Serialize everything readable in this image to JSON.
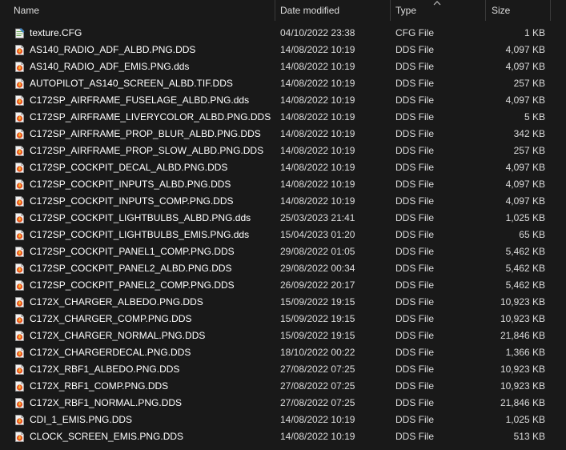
{
  "columns": {
    "name": "Name",
    "date": "Date modified",
    "type": "Type",
    "size": "Size"
  },
  "colors": {
    "background": "#191919",
    "text": "#ffffff",
    "dds_icon": "#e8531f",
    "cfg_icon": "#6aa84f"
  },
  "files": [
    {
      "name": "texture.CFG",
      "date": "04/10/2022 23:38",
      "type": "CFG File",
      "size": "1 KB",
      "icon": "cfg-file-icon"
    },
    {
      "name": "AS140_RADIO_ADF_ALBD.PNG.DDS",
      "date": "14/08/2022 10:19",
      "type": "DDS File",
      "size": "4,097 KB",
      "icon": "dds-file-icon"
    },
    {
      "name": "AS140_RADIO_ADF_EMIS.PNG.dds",
      "date": "14/08/2022 10:19",
      "type": "DDS File",
      "size": "4,097 KB",
      "icon": "dds-file-icon"
    },
    {
      "name": "AUTOPILOT_AS140_SCREEN_ALBD.TIF.DDS",
      "date": "14/08/2022 10:19",
      "type": "DDS File",
      "size": "257 KB",
      "icon": "dds-file-icon"
    },
    {
      "name": "C172SP_AIRFRAME_FUSELAGE_ALBD.PNG.dds",
      "date": "14/08/2022 10:19",
      "type": "DDS File",
      "size": "4,097 KB",
      "icon": "dds-file-icon"
    },
    {
      "name": "C172SP_AIRFRAME_LIVERYCOLOR_ALBD.PNG.DDS",
      "date": "14/08/2022 10:19",
      "type": "DDS File",
      "size": "5 KB",
      "icon": "dds-file-icon"
    },
    {
      "name": "C172SP_AIRFRAME_PROP_BLUR_ALBD.PNG.DDS",
      "date": "14/08/2022 10:19",
      "type": "DDS File",
      "size": "342 KB",
      "icon": "dds-file-icon"
    },
    {
      "name": "C172SP_AIRFRAME_PROP_SLOW_ALBD.PNG.DDS",
      "date": "14/08/2022 10:19",
      "type": "DDS File",
      "size": "257 KB",
      "icon": "dds-file-icon"
    },
    {
      "name": "C172SP_COCKPIT_DECAL_ALBD.PNG.DDS",
      "date": "14/08/2022 10:19",
      "type": "DDS File",
      "size": "4,097 KB",
      "icon": "dds-file-icon"
    },
    {
      "name": "C172SP_COCKPIT_INPUTS_ALBD.PNG.DDS",
      "date": "14/08/2022 10:19",
      "type": "DDS File",
      "size": "4,097 KB",
      "icon": "dds-file-icon"
    },
    {
      "name": "C172SP_COCKPIT_INPUTS_COMP.PNG.DDS",
      "date": "14/08/2022 10:19",
      "type": "DDS File",
      "size": "4,097 KB",
      "icon": "dds-file-icon"
    },
    {
      "name": "C172SP_COCKPIT_LIGHTBULBS_ALBD.PNG.dds",
      "date": "25/03/2023 21:41",
      "type": "DDS File",
      "size": "1,025 KB",
      "icon": "dds-file-icon"
    },
    {
      "name": "C172SP_COCKPIT_LIGHTBULBS_EMIS.PNG.dds",
      "date": "15/04/2023 01:20",
      "type": "DDS File",
      "size": "65 KB",
      "icon": "dds-file-icon"
    },
    {
      "name": "C172SP_COCKPIT_PANEL1_COMP.PNG.DDS",
      "date": "29/08/2022 01:05",
      "type": "DDS File",
      "size": "5,462 KB",
      "icon": "dds-file-icon"
    },
    {
      "name": "C172SP_COCKPIT_PANEL2_ALBD.PNG.DDS",
      "date": "29/08/2022 00:34",
      "type": "DDS File",
      "size": "5,462 KB",
      "icon": "dds-file-icon"
    },
    {
      "name": "C172SP_COCKPIT_PANEL2_COMP.PNG.DDS",
      "date": "26/09/2022 20:17",
      "type": "DDS File",
      "size": "5,462 KB",
      "icon": "dds-file-icon"
    },
    {
      "name": "C172X_CHARGER_ALBEDO.PNG.DDS",
      "date": "15/09/2022 19:15",
      "type": "DDS File",
      "size": "10,923 KB",
      "icon": "dds-file-icon"
    },
    {
      "name": "C172X_CHARGER_COMP.PNG.DDS",
      "date": "15/09/2022 19:15",
      "type": "DDS File",
      "size": "10,923 KB",
      "icon": "dds-file-icon"
    },
    {
      "name": "C172X_CHARGER_NORMAL.PNG.DDS",
      "date": "15/09/2022 19:15",
      "type": "DDS File",
      "size": "21,846 KB",
      "icon": "dds-file-icon"
    },
    {
      "name": "C172X_CHARGERDECAL.PNG.DDS",
      "date": "18/10/2022 00:22",
      "type": "DDS File",
      "size": "1,366 KB",
      "icon": "dds-file-icon"
    },
    {
      "name": "C172X_RBF1_ALBEDO.PNG.DDS",
      "date": "27/08/2022 07:25",
      "type": "DDS File",
      "size": "10,923 KB",
      "icon": "dds-file-icon"
    },
    {
      "name": "C172X_RBF1_COMP.PNG.DDS",
      "date": "27/08/2022 07:25",
      "type": "DDS File",
      "size": "10,923 KB",
      "icon": "dds-file-icon"
    },
    {
      "name": "C172X_RBF1_NORMAL.PNG.DDS",
      "date": "27/08/2022 07:25",
      "type": "DDS File",
      "size": "21,846 KB",
      "icon": "dds-file-icon"
    },
    {
      "name": "CDI_1_EMIS.PNG.DDS",
      "date": "14/08/2022 10:19",
      "type": "DDS File",
      "size": "1,025 KB",
      "icon": "dds-file-icon"
    },
    {
      "name": "CLOCK_SCREEN_EMIS.PNG.DDS",
      "date": "14/08/2022 10:19",
      "type": "DDS File",
      "size": "513 KB",
      "icon": "dds-file-icon"
    }
  ]
}
